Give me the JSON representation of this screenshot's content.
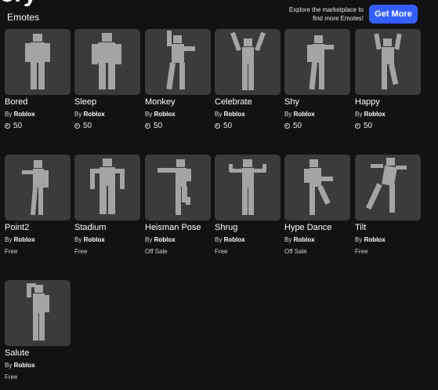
{
  "header": {
    "heading_fragment": "ory",
    "section_title": "Emotes",
    "promo_line1": "Explore the marketplace to",
    "promo_line2": "find more Emotes!",
    "get_more_label": "Get More"
  },
  "items": [
    {
      "name": "Bored",
      "by": "By",
      "creator": "Roblox",
      "price": "50",
      "has_robux": true
    },
    {
      "name": "Sleep",
      "by": "By",
      "creator": "Roblox",
      "price": "50",
      "has_robux": true
    },
    {
      "name": "Monkey",
      "by": "By",
      "creator": "Roblox",
      "price": "50",
      "has_robux": true
    },
    {
      "name": "Celebrate",
      "by": "By",
      "creator": "Roblox",
      "price": "50",
      "has_robux": true
    },
    {
      "name": "Shy",
      "by": "By",
      "creator": "Roblox",
      "price": "50",
      "has_robux": true
    },
    {
      "name": "Happy",
      "by": "By",
      "creator": "Roblox",
      "price": "50",
      "has_robux": true
    },
    {
      "name": "Point2",
      "by": "By",
      "creator": "Roblox",
      "price": "Free",
      "has_robux": false
    },
    {
      "name": "Stadium",
      "by": "By",
      "creator": "Roblox",
      "price": "Free",
      "has_robux": false
    },
    {
      "name": "Heisman Pose",
      "by": "By",
      "creator": "Roblox",
      "price": "Off Sale",
      "has_robux": false
    },
    {
      "name": "Shrug",
      "by": "By",
      "creator": "Roblox",
      "price": "Free",
      "has_robux": false
    },
    {
      "name": "Hype Dance",
      "by": "By",
      "creator": "Roblox",
      "price": "Off Sale",
      "has_robux": false
    },
    {
      "name": "Tilt",
      "by": "By",
      "creator": "Roblox",
      "price": "Free",
      "has_robux": false
    },
    {
      "name": "Salute",
      "by": "By",
      "creator": "Roblox",
      "price": "Free",
      "has_robux": false
    }
  ],
  "colors": {
    "background": "#121215",
    "thumb": "#393b3d",
    "figure": "#a3a4a6",
    "accent": "#335fff"
  }
}
